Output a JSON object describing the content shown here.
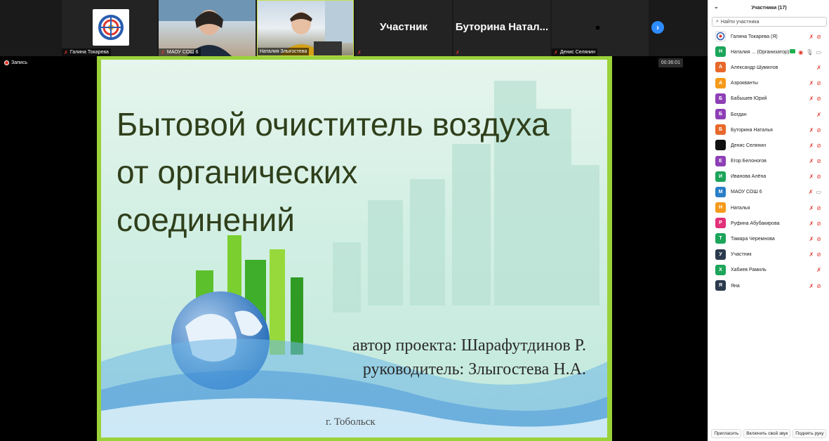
{
  "video_strip": {
    "tiles": [
      {
        "name": "Галина Токарева"
      },
      {
        "name": "МАОУ СОШ 6"
      },
      {
        "name": "Наталия Злыгостева"
      },
      {
        "big_label": "Участник"
      },
      {
        "big_label": "Буторина  Натал..."
      },
      {
        "name": "Денис Селянин"
      }
    ]
  },
  "stage": {
    "recording_label": "Запись",
    "timer": "00:36:01"
  },
  "slide": {
    "title_lines": [
      "Бытовой очиститель воздуха",
      "от органических",
      "соединений"
    ],
    "author_line": "автор проекта: Шарафутдинов Р.",
    "supervisor_line": "руководитель: Злыгостева Н.А.",
    "city": "г. Тобольск"
  },
  "participants": {
    "header": "Участники (17)",
    "search_placeholder": "Найти участника",
    "list": [
      {
        "initial": "",
        "name": "Галина Токарева (Я)",
        "color": "#ffffff"
      },
      {
        "initial": "Н",
        "name": "Наталия ... (Организатор)",
        "color": "#1ca55a"
      },
      {
        "initial": "А",
        "name": "Александр Шумилов",
        "color": "#e7682a"
      },
      {
        "initial": "А",
        "name": "Аэрокванты",
        "color": "#f59a1b"
      },
      {
        "initial": "Б",
        "name": "Бабышев Юрий",
        "color": "#8e3fb6"
      },
      {
        "initial": "Б",
        "name": "Богдан",
        "color": "#8e3fb6"
      },
      {
        "initial": "Б",
        "name": "Буторина Наталья",
        "color": "#e7682a"
      },
      {
        "initial": "",
        "name": "Денис Селянин",
        "color": "#111111"
      },
      {
        "initial": "Е",
        "name": "Егор Белоногов",
        "color": "#8e3fb6"
      },
      {
        "initial": "И",
        "name": "Иванова Алёна",
        "color": "#1ca55a"
      },
      {
        "initial": "М",
        "name": "МАОУ СОШ 6",
        "color": "#2a7fc7"
      },
      {
        "initial": "Н",
        "name": "Наталья",
        "color": "#f59a1b"
      },
      {
        "initial": "Р",
        "name": "Руфина Абубакирова",
        "color": "#e2307a"
      },
      {
        "initial": "Т",
        "name": "Тамара Черемнова",
        "color": "#1ca55a"
      },
      {
        "initial": "У",
        "name": "Участник",
        "color": "#2b3a4d"
      },
      {
        "initial": "Х",
        "name": "Хабиев Рамиль",
        "color": "#1ca55a"
      },
      {
        "initial": "Я",
        "name": "Яна",
        "color": "#2b3a4d"
      }
    ],
    "footer": {
      "invite": "Пригласить",
      "unmute_me": "Включить свой звук",
      "raise_hand": "Поднять руку"
    }
  },
  "colors": {
    "accent": "#2d8cff",
    "muted_red": "#e0362c",
    "slide_border": "#9bd23a"
  }
}
